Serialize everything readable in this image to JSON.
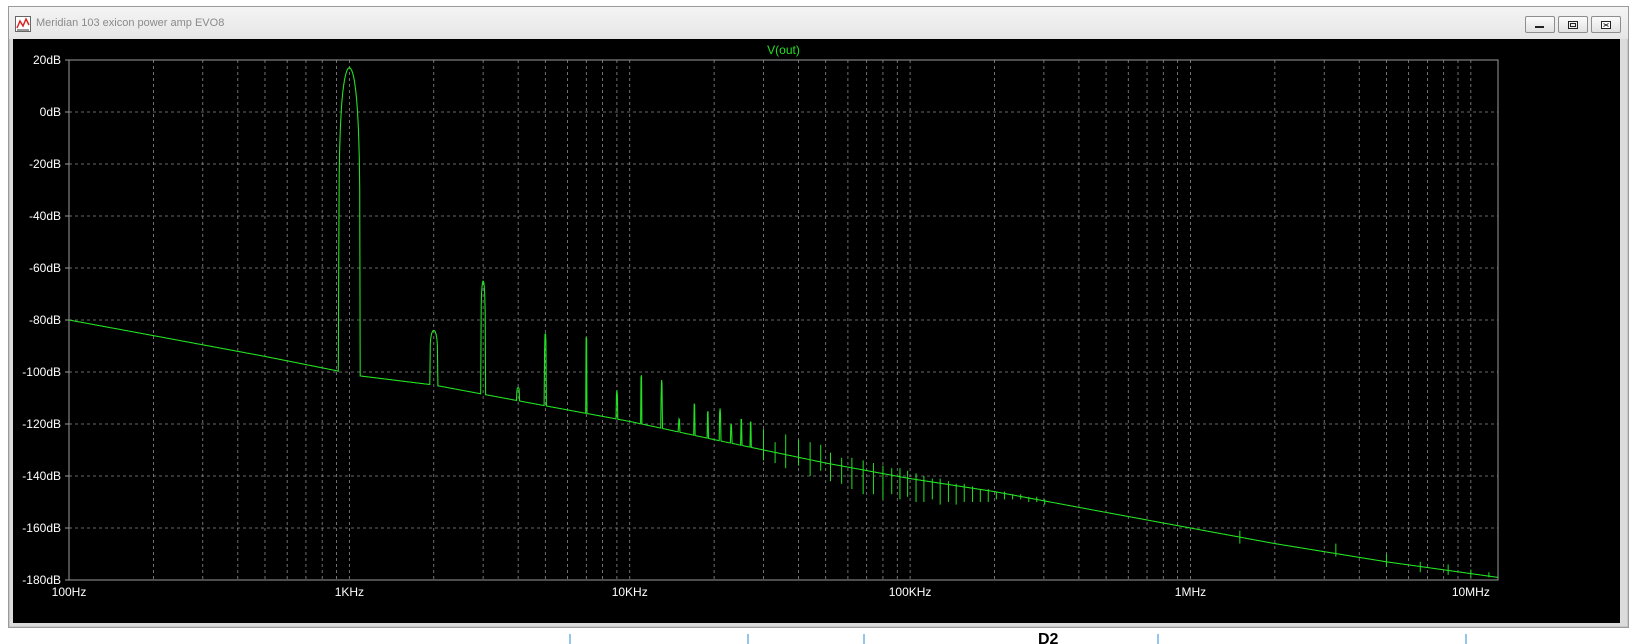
{
  "window": {
    "title": "Meridian 103 exicon power amp EVO8"
  },
  "background": {
    "label": "D2"
  },
  "colors": {
    "trace": "#22e122",
    "grid": "#8c8c8c",
    "plot_bg": "#000000",
    "frame": "#9c9c9c"
  },
  "icons": {
    "window": "waveform-icon",
    "minimize": "minimize-icon",
    "maximize": "restore-icon",
    "close": "close-icon"
  },
  "chart_data": {
    "type": "line",
    "title": "V(out)",
    "x_scale": "log",
    "xlim": [
      100,
      12500000
    ],
    "ylim": [
      -180,
      20
    ],
    "grid": true,
    "x_ticks": [
      {
        "value": 100,
        "label": "100Hz"
      },
      {
        "value": 1000,
        "label": "1KHz"
      },
      {
        "value": 10000,
        "label": "10KHz"
      },
      {
        "value": 100000,
        "label": "100KHz"
      },
      {
        "value": 1000000,
        "label": "1MHz"
      },
      {
        "value": 10000000,
        "label": "10MHz"
      }
    ],
    "y_ticks": [
      {
        "value": 20,
        "label": "20dB"
      },
      {
        "value": 0,
        "label": "0dB"
      },
      {
        "value": -20,
        "label": "-20dB"
      },
      {
        "value": -40,
        "label": "-40dB"
      },
      {
        "value": -60,
        "label": "-60dB"
      },
      {
        "value": -80,
        "label": "-80dB"
      },
      {
        "value": -100,
        "label": "-100dB"
      },
      {
        "value": -120,
        "label": "-120dB"
      },
      {
        "value": -140,
        "label": "-140dB"
      },
      {
        "value": -160,
        "label": "-160dB"
      },
      {
        "value": -180,
        "label": "-180dB"
      }
    ],
    "series": [
      {
        "name": "V(out)",
        "floor": [
          [
            100,
            -80
          ],
          [
            200,
            -86
          ],
          [
            500,
            -94
          ],
          [
            900,
            -99.5
          ],
          [
            1000,
            -101
          ],
          [
            2000,
            -105
          ],
          [
            5000,
            -113
          ],
          [
            10000,
            -119
          ],
          [
            20000,
            -126
          ],
          [
            50000,
            -135
          ],
          [
            100000,
            -141
          ],
          [
            200000,
            -146
          ],
          [
            500000,
            -154
          ],
          [
            1000000,
            -160
          ],
          [
            2000000,
            -166
          ],
          [
            5000000,
            -173
          ],
          [
            12500000,
            -179
          ]
        ],
        "peaks": [
          {
            "f": 1000,
            "db": 17,
            "w": 0.038
          },
          {
            "f": 2000,
            "db": -84,
            "w": 0.014
          },
          {
            "f": 3000,
            "db": -65,
            "w": 0.008
          },
          {
            "f": 4000,
            "db": -106,
            "w": 0.005
          },
          {
            "f": 5000,
            "db": -85,
            "w": 0.003
          },
          {
            "f": 6000,
            "db": -115,
            "w": 0.002
          },
          {
            "f": 7000,
            "db": -86,
            "w": 0.002
          },
          {
            "f": 8000,
            "db": -118,
            "w": 0.002
          },
          {
            "f": 9000,
            "db": -107,
            "w": 0.002
          },
          {
            "f": 10000,
            "db": -119,
            "w": 0.002
          },
          {
            "f": 11000,
            "db": -101,
            "w": 0.002
          },
          {
            "f": 12000,
            "db": -122,
            "w": 0.002
          },
          {
            "f": 13000,
            "db": -103,
            "w": 0.002
          },
          {
            "f": 15000,
            "db": -118,
            "w": 0.002
          },
          {
            "f": 17000,
            "db": -112,
            "w": 0.002
          },
          {
            "f": 19000,
            "db": -115,
            "w": 0.002
          },
          {
            "f": 21000,
            "db": -114,
            "w": 0.002
          },
          {
            "f": 23000,
            "db": -120,
            "w": 0.002
          },
          {
            "f": 25000,
            "db": -118,
            "w": 0.002
          },
          {
            "f": 27000,
            "db": -119,
            "w": 0.002
          }
        ],
        "spurs": [
          [
            30000,
            -122,
            -134
          ],
          [
            33000,
            -127,
            -135
          ],
          [
            36000,
            -124,
            -137
          ],
          [
            40000,
            -126,
            -136
          ],
          [
            44000,
            -127,
            -140
          ],
          [
            48000,
            -128,
            -138
          ],
          [
            52000,
            -131,
            -142
          ],
          [
            57000,
            -133,
            -143
          ],
          [
            62000,
            -133,
            -145
          ],
          [
            68000,
            -134,
            -147
          ],
          [
            74000,
            -135,
            -147
          ],
          [
            80000,
            -136,
            -149
          ],
          [
            86000,
            -137,
            -147
          ],
          [
            92000,
            -137,
            -149
          ],
          [
            98000,
            -138,
            -148
          ],
          [
            105000,
            -139,
            -150
          ],
          [
            112000,
            -140,
            -150
          ],
          [
            120000,
            -141,
            -149
          ],
          [
            128000,
            -141,
            -151
          ],
          [
            137000,
            -142,
            -150
          ],
          [
            146000,
            -143,
            -151
          ],
          [
            156000,
            -143,
            -150
          ],
          [
            167000,
            -144,
            -150
          ],
          [
            178000,
            -145,
            -150
          ],
          [
            190000,
            -145,
            -150
          ],
          [
            203000,
            -146,
            -149
          ],
          [
            217000,
            -146,
            -149
          ],
          [
            232000,
            -147,
            -149
          ],
          [
            248000,
            -147,
            -149
          ],
          [
            265000,
            -148,
            -150
          ],
          [
            283000,
            -148,
            -150
          ],
          [
            302000,
            -149,
            -151
          ],
          [
            1500000,
            -161,
            -166
          ],
          [
            3300000,
            -166,
            -171
          ],
          [
            5000000,
            -170,
            -175
          ],
          [
            6600000,
            -173,
            -177
          ],
          [
            8300000,
            -174,
            -178
          ],
          [
            10000000,
            -176,
            -179
          ],
          [
            11600000,
            -177,
            -179
          ]
        ]
      }
    ]
  }
}
